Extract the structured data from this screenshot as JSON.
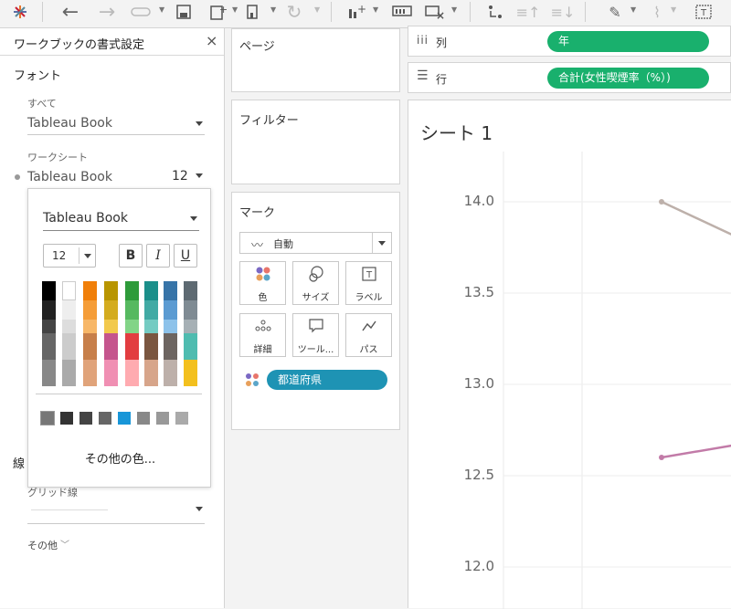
{
  "format_pane": {
    "title": "ワークブックの書式設定",
    "close_glyph": "×",
    "font_section": "フォント",
    "all_label": "すべて",
    "all_font": "Tableau Book",
    "worksheet_label": "ワークシート",
    "worksheet_font": "Tableau Book",
    "worksheet_size": "12",
    "lines_partial": "線",
    "grid_lines_label": "グリッド線",
    "other_label": "その他"
  },
  "font_popup": {
    "font_name": "Tableau Book",
    "size": "12",
    "bold": "B",
    "italic": "I",
    "underline": "U",
    "more_colors": "その他の色...",
    "palette_columns": [
      [
        "#000000",
        "#222222",
        "#444444",
        "#666666",
        "#888888"
      ],
      [
        "#ffffff",
        "#eeeeee",
        "#dddddd",
        "#cccccc",
        "#aaaaaa"
      ],
      [
        "#f07f09",
        "#f59d38",
        "#f7b768",
        "#c77f4a",
        "#e0a37a"
      ],
      [
        "#b89500",
        "#d4ac1f",
        "#f2c94c",
        "#c5558d",
        "#f08fb3"
      ],
      [
        "#2e9b3a",
        "#56b960",
        "#82d487",
        "#e23d40",
        "#ffabb0"
      ],
      [
        "#1b8f8a",
        "#41aaa4",
        "#74cbc2",
        "#7a5640",
        "#d7a58a"
      ],
      [
        "#3774a8",
        "#5b9bd2",
        "#8dc2ea",
        "#6d6561",
        "#bdb0aa"
      ],
      [
        "#5e6a72",
        "#7f8b93",
        "#a6b0b5",
        "#4fbcb0",
        "#f3c01e"
      ]
    ],
    "recent_colors": [
      "#777777",
      "#333333",
      "#444444",
      "#666666",
      "#1896d8",
      "#888888",
      "#999999",
      "#aaaaaa"
    ]
  },
  "pages_panel": {
    "title": "ページ"
  },
  "filters_panel": {
    "title": "フィルター"
  },
  "marks_panel": {
    "title": "マーク",
    "mark_type": "自動",
    "buttons": [
      {
        "label": "色",
        "icon": "color-icon"
      },
      {
        "label": "サイズ",
        "icon": "size-icon"
      },
      {
        "label": "ラベル",
        "icon": "label-icon"
      },
      {
        "label": "詳細",
        "icon": "detail-icon"
      },
      {
        "label": "ツール...",
        "icon": "tooltip-icon"
      },
      {
        "label": "パス",
        "icon": "path-icon"
      }
    ],
    "color_pill": "都道府県"
  },
  "columns_shelf": {
    "label": "列",
    "pill": "年"
  },
  "rows_shelf": {
    "label": "行",
    "pill": "合計(女性喫煙率（%）)"
  },
  "sheet": {
    "title": "シート 1",
    "y_ticks": [
      "14.0",
      "13.5",
      "13.0",
      "12.5",
      "12.0"
    ],
    "series_colors": [
      "#bdb0aa",
      "#c27ba8"
    ]
  }
}
